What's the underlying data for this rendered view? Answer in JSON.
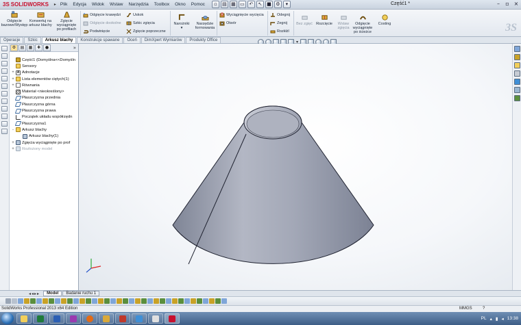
{
  "app": {
    "logo": "SOLIDWORKS",
    "logo_prefix": "3S",
    "menu": [
      "Plik",
      "Edycja",
      "Widok",
      "Wstaw",
      "Narzędzia",
      "Toolbox",
      "Okno",
      "Pomoc"
    ],
    "doc_title": "Część1 *",
    "window_controls": [
      "minimize",
      "restore",
      "close"
    ]
  },
  "ribbon": {
    "big_buttons": [
      {
        "label": "Odgięcie bazowe/Występ",
        "icon": "base-flange-icon"
      },
      {
        "label": "Konwertuj na arkusz blachy",
        "icon": "convert-sheet-icon"
      },
      {
        "label": "Zgięcie wyciągnięte po profilach",
        "icon": "lofted-bend-icon"
      }
    ],
    "col1": [
      {
        "label": "Odgięcie krawędzi",
        "disabled": false
      },
      {
        "label": "Odgięcie dookolne",
        "disabled": true
      },
      {
        "label": "Podwinięcie",
        "disabled": false
      }
    ],
    "col2": [
      {
        "label": "Uskok",
        "disabled": false
      },
      {
        "label": "Szkic zgięcia",
        "disabled": false
      },
      {
        "label": "Zgięcie poprzeczne",
        "disabled": false
      }
    ],
    "narozniki": "Narożniki",
    "narzedzie_formowania": "Narzędzie formowania",
    "col3": [
      {
        "label": "Wyciągnięcie wycięcia",
        "disabled": false
      },
      {
        "label": "Otwór",
        "disabled": false
      }
    ],
    "col4": [
      {
        "label": "Odegnij",
        "disabled": false
      },
      {
        "label": "Zegnij",
        "disabled": false
      },
      {
        "label": "Rozkłżl",
        "disabled": false
      }
    ],
    "right_buttons": [
      {
        "label": "Bez zgięć",
        "disabled": true
      },
      {
        "label": "Rozcięcie",
        "disabled": false
      },
      {
        "label": "Wstaw zgięcia",
        "disabled": true
      },
      {
        "label": "Odgięcie wyciągnięte po ścieżce",
        "disabled": false
      },
      {
        "label": "Costing",
        "disabled": false
      }
    ]
  },
  "tabs": [
    "Operacje",
    "Szkic",
    "Arkusz blachy",
    "Konstrukcje spawane",
    "Oceń",
    "DimXpert Wymiarów",
    "Produkty Office"
  ],
  "active_tab": "Arkusz blachy",
  "tree": [
    {
      "label": "Część1  (Domyślna<<Domyśln",
      "icon": "part-icon",
      "exp": ""
    },
    {
      "label": "Sensory",
      "icon": "folder-icon",
      "exp": ""
    },
    {
      "label": "Adnotacje",
      "icon": "annotation-icon",
      "exp": "+"
    },
    {
      "label": "Lista elementów ciętych(1)",
      "icon": "folder-icon",
      "exp": "+"
    },
    {
      "label": "Równania",
      "icon": "sigma-icon",
      "exp": "+"
    },
    {
      "label": "Materiał <nieokreślony>",
      "icon": "material-icon",
      "exp": ""
    },
    {
      "label": "Płaszczyzna przednia",
      "icon": "plane-icon",
      "exp": ""
    },
    {
      "label": "Płaszczyzna górna",
      "icon": "plane-icon",
      "exp": ""
    },
    {
      "label": "Płaszczyzna prawa",
      "icon": "plane-icon",
      "exp": ""
    },
    {
      "label": "Początek układu współrzędn",
      "icon": "origin-icon",
      "exp": ""
    },
    {
      "label": "Płaszczyzna1",
      "icon": "plane-icon",
      "exp": ""
    },
    {
      "label": "Arkusz blachy",
      "icon": "folder-icon",
      "exp": "-"
    },
    {
      "label": "Arkusz blachy(1)",
      "icon": "sheet-icon",
      "exp": "",
      "indent": true
    },
    {
      "label": "Zgięcia wyciągnięte po prof",
      "icon": "sheet-icon",
      "exp": "+"
    },
    {
      "label": "Rozłożony model",
      "icon": "sheet-icon",
      "exp": "+",
      "dim": true
    }
  ],
  "bottom_tabs": [
    "Model",
    "Badanie ruchu 1"
  ],
  "active_bottom_tab": "Model",
  "status": {
    "left": "SolidWorks Professional 2013 x64 Edition",
    "units": "MMGS",
    "help": "?"
  },
  "tray": {
    "lang": "PL",
    "time": "13:38"
  },
  "colors": {
    "cone_fill": "#9ea3b2",
    "cone_top": "#b6bac6",
    "accent": "#c8102e",
    "tree_active": "#ffe39a"
  }
}
